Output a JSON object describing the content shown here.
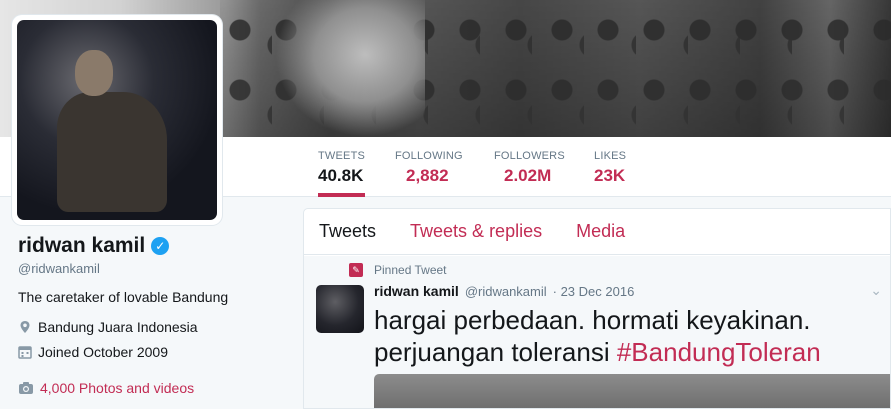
{
  "banner": {
    "alt": "cover-photo"
  },
  "profile": {
    "name": "ridwan kamil",
    "handle": "@ridwankamil",
    "bio": "The caretaker of lovable Bandung",
    "location": "Bandung Juara Indonesia",
    "joined": "Joined October 2009",
    "photos_link": "4,000 Photos and videos"
  },
  "stats": [
    {
      "label": "TWEETS",
      "value": "40.8K"
    },
    {
      "label": "FOLLOWING",
      "value": "2,882"
    },
    {
      "label": "FOLLOWERS",
      "value": "2.02M"
    },
    {
      "label": "LIKES",
      "value": "23K"
    }
  ],
  "tabs": [
    {
      "label": "Tweets"
    },
    {
      "label": "Tweets & replies"
    },
    {
      "label": "Media"
    }
  ],
  "pinned_tweet": {
    "pinned_label": "Pinned Tweet",
    "name": "ridwan kamil",
    "handle": "@ridwankamil",
    "date": "· 23 Dec 2016",
    "text_plain": "hargai perbedaan. hormati keyakinan. perjuangan toleransi ",
    "hashtag": "#BandungToleran"
  },
  "colors": {
    "accent": "#c22c54",
    "verified": "#1da1f2"
  }
}
